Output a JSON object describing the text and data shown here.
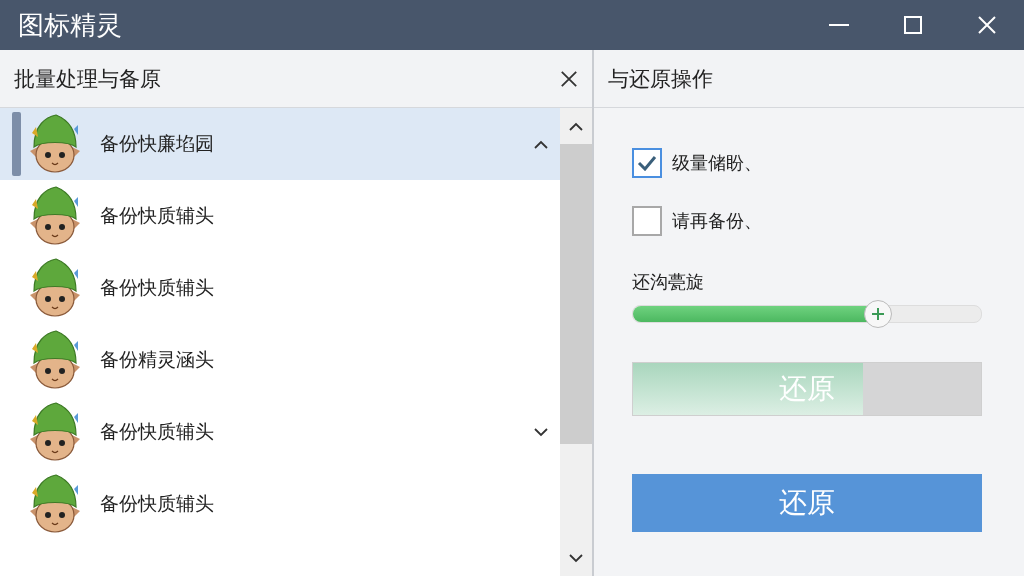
{
  "window": {
    "title": "图标精灵"
  },
  "left_panel": {
    "title": "批量处理与备原",
    "items": [
      {
        "label": "备份快廉埳园",
        "selected": true,
        "expanded": true
      },
      {
        "label": "备份快质辅头",
        "selected": false
      },
      {
        "label": "备份快质辅头",
        "selected": false
      },
      {
        "label": "备份精灵涵头",
        "selected": false
      },
      {
        "label": "备份快质辅头",
        "selected": false,
        "expanded": false
      },
      {
        "label": "备份快质辅头",
        "selected": false
      }
    ]
  },
  "right_panel": {
    "title": "与还原操作",
    "options": [
      {
        "label": "级量储盼、",
        "checked": true
      },
      {
        "label": "请再备份、",
        "checked": false
      }
    ],
    "slider": {
      "label": "还沟甍旋",
      "level": 0.7
    },
    "progress_button": {
      "label": "还原",
      "level": 0.66
    },
    "button": {
      "label": "还原"
    }
  }
}
